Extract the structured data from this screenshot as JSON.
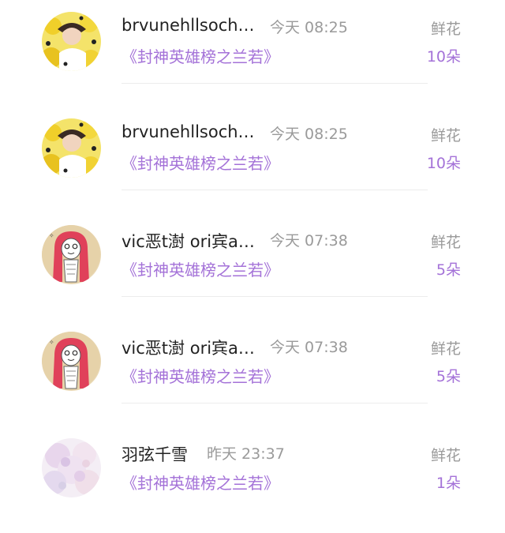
{
  "records": [
    {
      "user": "brvunehllsoch…",
      "time": "今天 08:25",
      "book": "《封神英雄榜之兰若》",
      "gift_type": "鲜花",
      "gift_count": "10朵",
      "avatar": "yellow-flower-portrait"
    },
    {
      "user": "brvunehllsoch…",
      "time": "今天 08:25",
      "book": "《封神英雄榜之兰若》",
      "gift_type": "鲜花",
      "gift_count": "10朵",
      "avatar": "yellow-flower-portrait"
    },
    {
      "user": "vic恶t澍 ori宾a…",
      "time": "今天 07:38",
      "book": "《封神英雄榜之兰若》",
      "gift_type": "鲜花",
      "gift_count": "5朵",
      "avatar": "red-haired-cartoon"
    },
    {
      "user": "vic恶t澍 ori宾a…",
      "time": "今天 07:38",
      "book": "《封神英雄榜之兰若》",
      "gift_type": "鲜花",
      "gift_count": "5朵",
      "avatar": "red-haired-cartoon"
    },
    {
      "user": "羽弦千雪",
      "time": "昨天 23:37",
      "book": "《封神英雄榜之兰若》",
      "gift_type": "鲜花",
      "gift_count": "1朵",
      "avatar": "pastel-floral"
    }
  ],
  "colors": {
    "accent": "#a472d8",
    "muted": "#9a9a9a",
    "text": "#222222",
    "divider": "#ececec"
  }
}
